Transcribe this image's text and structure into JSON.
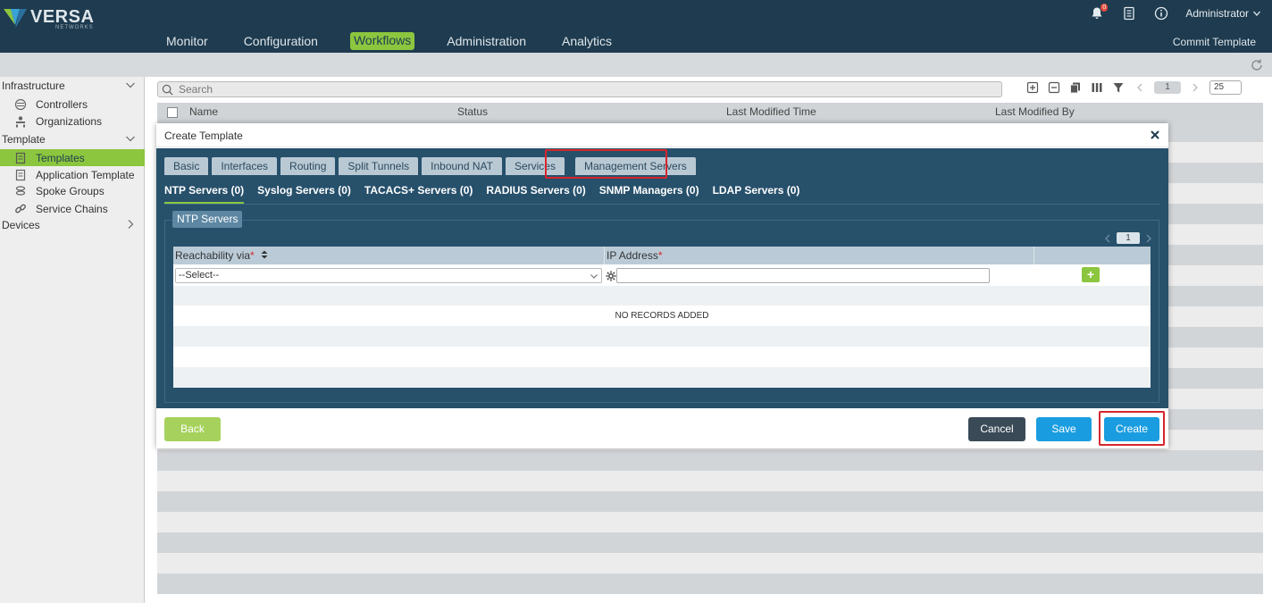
{
  "header": {
    "brand": "VERSA",
    "brand_sub": "NETWORKS",
    "nav": [
      "Monitor",
      "Configuration",
      "Workflows",
      "Administration",
      "Analytics"
    ],
    "active_nav": "Workflows",
    "notification_count": "0",
    "user": "Administrator",
    "commit_label": "Commit Template",
    "brand_color": "#1e3b4f",
    "accent_color": "#8cc63f"
  },
  "sidebar": {
    "infrastructure": "Infrastructure",
    "controllers": "Controllers",
    "organizations": "Organizations",
    "template": "Template",
    "templates": "Templates",
    "application_template": "Application Template",
    "spoke_groups": "Spoke Groups",
    "service_chains": "Service Chains",
    "devices": "Devices"
  },
  "list": {
    "search_placeholder": "Search",
    "page": "1",
    "page_size": "25",
    "columns": [
      "Name",
      "Status",
      "Last Modified Time",
      "Last Modified By"
    ]
  },
  "modal": {
    "title": "Create Template",
    "tabs": [
      "Basic",
      "Interfaces",
      "Routing",
      "Split Tunnels",
      "Inbound NAT",
      "Services",
      "Management Servers"
    ],
    "active_tab": "Management Servers",
    "subtabs": [
      "NTP Servers (0)",
      "Syslog Servers (0)",
      "TACACS+ Servers (0)",
      "RADIUS Servers (0)",
      "SNMP Managers (0)",
      "LDAP Servers (0)"
    ],
    "active_subtab": "NTP Servers (0)",
    "section": "NTP Servers",
    "grid_page": "1",
    "col_reachability": "Reachability via",
    "col_ip": "IP Address",
    "required_mark": "*",
    "select_value": "--Select--",
    "add_label": "+",
    "empty": "NO RECORDS ADDED",
    "back": "Back",
    "cancel": "Cancel",
    "save": "Save",
    "create": "Create"
  }
}
